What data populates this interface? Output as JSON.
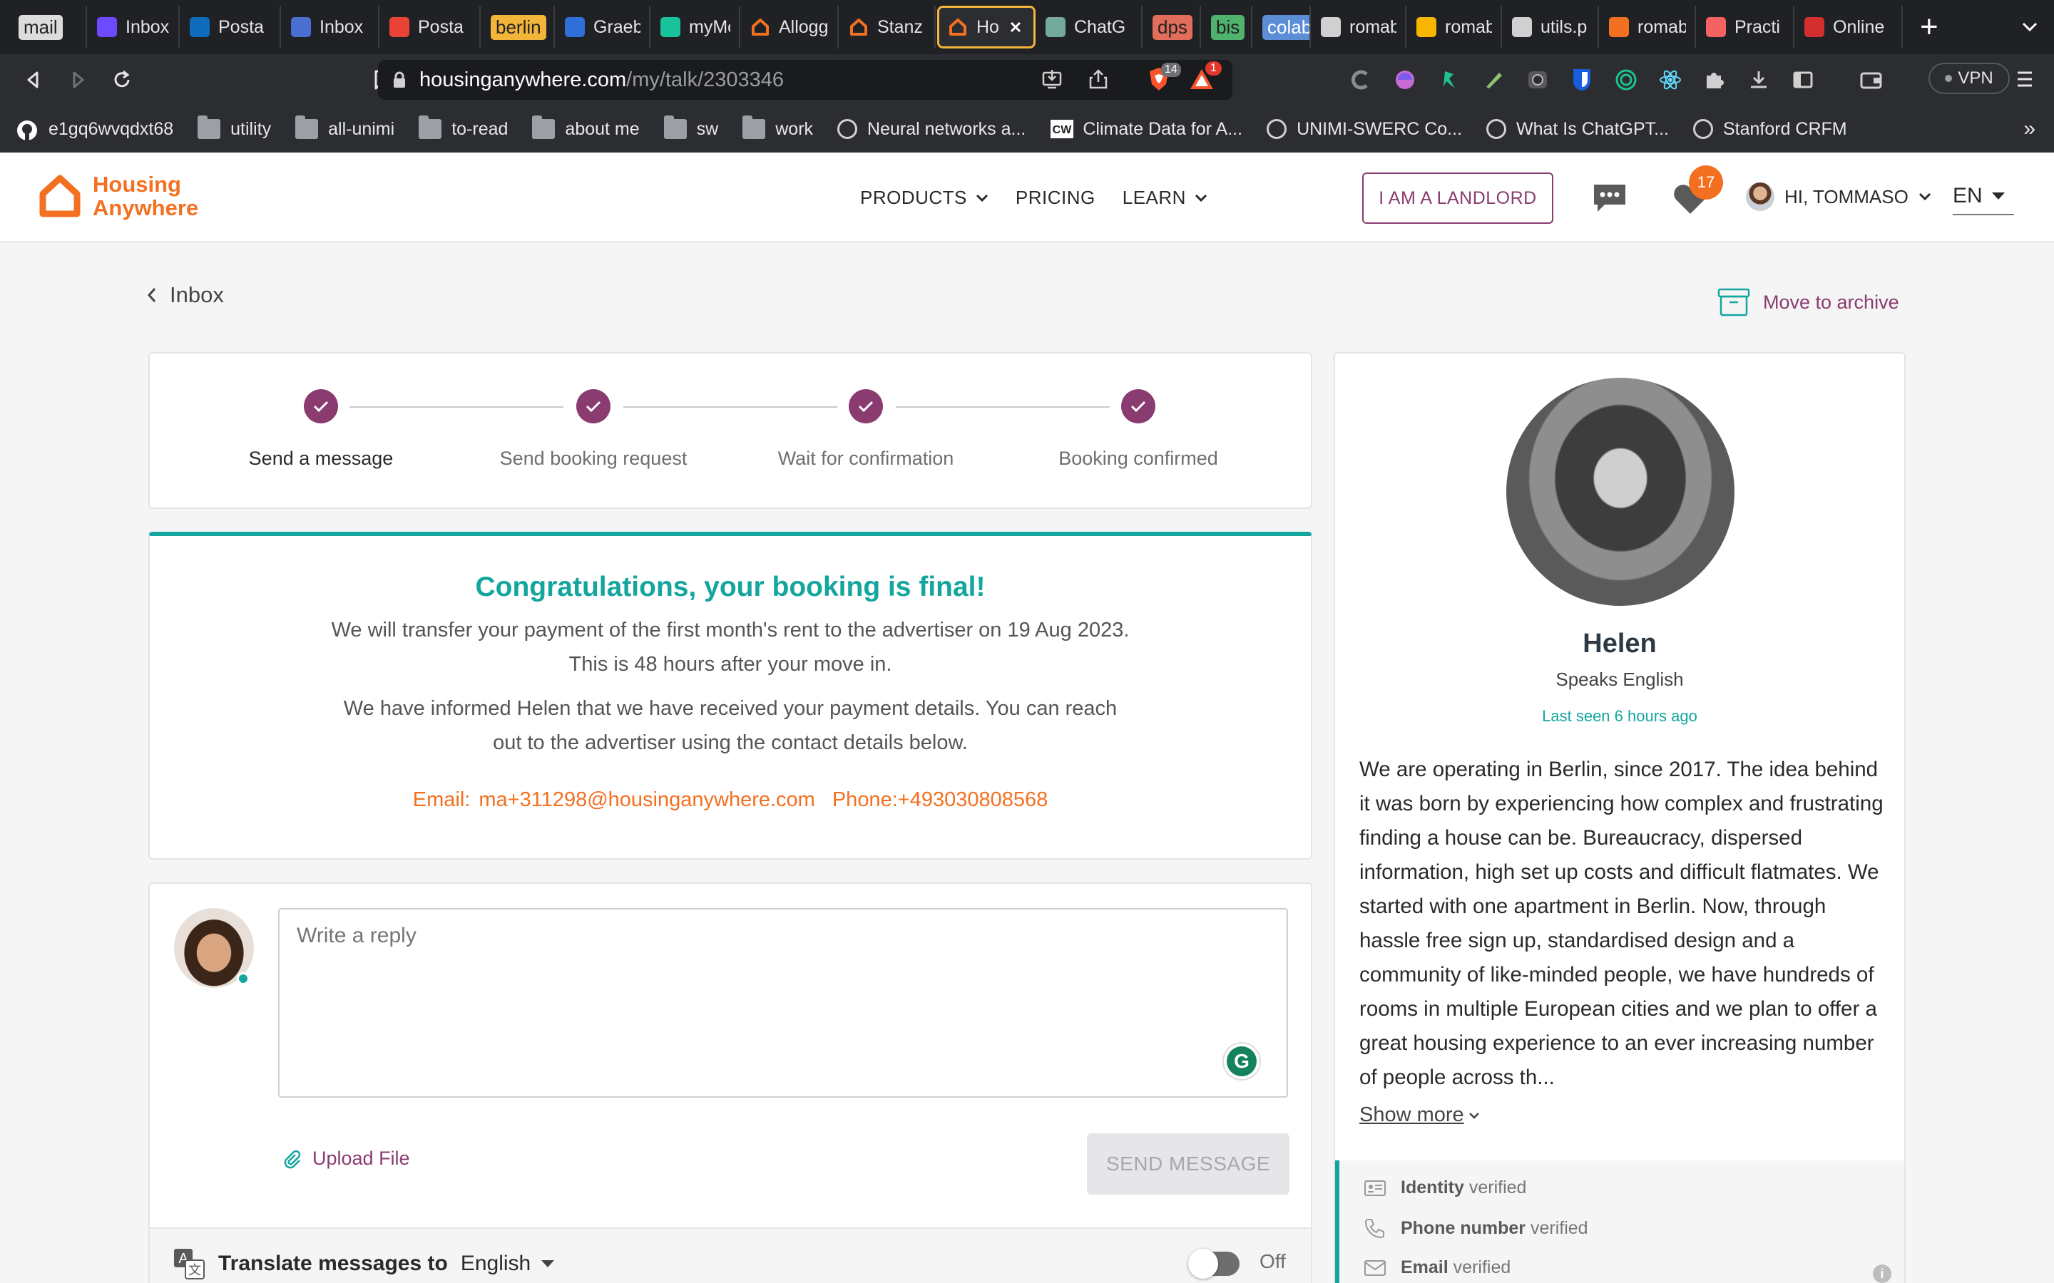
{
  "browser": {
    "tabs": [
      {
        "label": "mail",
        "style": "chip",
        "color": "#dcdcdc",
        "text_color": "#222"
      },
      {
        "label": "Inbox",
        "icon": "proton-mail-icon",
        "color": "#6d4aff"
      },
      {
        "label": "Posta",
        "icon": "outlook-icon",
        "color": "#0f6cbd"
      },
      {
        "label": "Inbox",
        "icon": "ox-mail-icon",
        "color": "#4a6fd1"
      },
      {
        "label": "Posta",
        "icon": "gmail-icon",
        "color": "#ea4335"
      },
      {
        "label": "berlin",
        "style": "chip",
        "color": "#f2b53a",
        "text_color": "#222"
      },
      {
        "label": "Graeb",
        "icon": "g-app-icon",
        "color": "#2f6fd8"
      },
      {
        "label": "myMo",
        "icon": "v-app-icon",
        "color": "#19c29a"
      },
      {
        "label": "Allogg",
        "icon": "house-icon",
        "color": "#f37021"
      },
      {
        "label": "Stanz",
        "icon": "house-icon",
        "color": "#f37021"
      },
      {
        "label": "Ho",
        "icon": "house-icon",
        "color": "#f37021",
        "active": true
      },
      {
        "label": "ChatG",
        "icon": "openai-icon",
        "color": "#74aa9c"
      },
      {
        "label": "dps",
        "style": "chip",
        "color": "#e26d5a",
        "text_color": "#222"
      },
      {
        "label": "bis",
        "style": "chip",
        "color": "#4fb36d",
        "text_color": "#222"
      },
      {
        "label": "colab",
        "style": "chip",
        "color": "#5b8ed6",
        "text_color": "#fff"
      },
      {
        "label": "romab",
        "icon": "infinity-icon",
        "color": "#d0d0d0"
      },
      {
        "label": "romab",
        "icon": "google-drive-icon",
        "color": "#f7b500"
      },
      {
        "label": "utils.p",
        "icon": "file-icon",
        "color": "#d0d0d0"
      },
      {
        "label": "romab",
        "icon": "infinity-icon",
        "color": "#f37021"
      },
      {
        "label": "Practi",
        "icon": "bell-icon",
        "color": "#f56262"
      },
      {
        "label": "Online",
        "icon": "b-app-icon",
        "color": "#d32f2f"
      }
    ],
    "url_host": "housinganywhere.com",
    "url_path": "/my/talk/2303346",
    "brave_badge": "14",
    "alert_badge": "1",
    "vpn_label": "VPN",
    "bookmarks": [
      {
        "label": "e1gq6wvqdxt68",
        "icon": "github-icon"
      },
      {
        "label": "utility",
        "icon": "folder-icon"
      },
      {
        "label": "all-unimi",
        "icon": "folder-icon"
      },
      {
        "label": "to-read",
        "icon": "folder-icon"
      },
      {
        "label": "about me",
        "icon": "folder-icon"
      },
      {
        "label": "sw",
        "icon": "folder-icon"
      },
      {
        "label": "work",
        "icon": "folder-icon"
      },
      {
        "label": "Neural networks a...",
        "icon": "globe-icon"
      },
      {
        "label": "Climate Data for A...",
        "icon": "cw-icon"
      },
      {
        "label": "UNIMI-SWERC Co...",
        "icon": "globe-icon"
      },
      {
        "label": "What Is ChatGPT...",
        "icon": "globe-icon"
      },
      {
        "label": "Stanford CRFM",
        "icon": "globe-icon"
      }
    ],
    "bookmarks_more": "»"
  },
  "header": {
    "logo_line1": "Housing",
    "logo_line2": "Anywhere",
    "nav": {
      "products": "PRODUCTS",
      "pricing": "PRICING",
      "learn": "LEARN"
    },
    "landlord_button": "I AM A LANDLORD",
    "favorites_count": "17",
    "greeting": "HI, TOMMASO",
    "language": "EN"
  },
  "page": {
    "back_label": "Inbox",
    "archive_label": "Move to archive",
    "steps": [
      {
        "label": "Send a message"
      },
      {
        "label": "Send booking request"
      },
      {
        "label": "Wait for confirmation"
      },
      {
        "label": "Booking confirmed"
      }
    ],
    "congrats": {
      "title": "Congratulations, your booking is final!",
      "p1": "We will transfer your payment of the first month's rent to the advertiser on 19 Aug 2023. This is 48 hours after your move in.",
      "p2": "We have informed Helen that we have received your payment details. You can reach out to the advertiser using the contact details below.",
      "email": "Email: ma+311298@housinganywhere.com",
      "phone": "Phone:+493030808568"
    },
    "reply": {
      "placeholder": "Write a reply",
      "upload_label": "Upload File",
      "send_label": "SEND MESSAGE",
      "translate_label": "Translate messages to",
      "translate_language": "English",
      "toggle_label": "Off"
    },
    "profile": {
      "name": "Helen",
      "speaks": "Speaks English",
      "last_seen": "Last seen 6 hours ago",
      "bio": "We are operating in Berlin, since 2017. The idea behind it was born by experiencing how complex and frustrating finding a house can be. Bureaucracy, dispersed information, high set up costs and difficult flatmates. We started with one apartment in Berlin. Now, through hassle free sign up, standardised design and a community of like-minded people, we have hundreds of rooms in multiple European cities and we plan to offer a great housing experience to an ever increasing number of people across th...",
      "show_more": "Show more",
      "verifications": [
        {
          "label": "Identity",
          "status": "verified"
        },
        {
          "label": "Phone number",
          "status": "verified"
        },
        {
          "label": "Email",
          "status": "verified"
        }
      ]
    }
  },
  "colors": {
    "brand_orange": "#f37021",
    "brand_purple": "#8a3b6f",
    "teal": "#14a69e"
  }
}
